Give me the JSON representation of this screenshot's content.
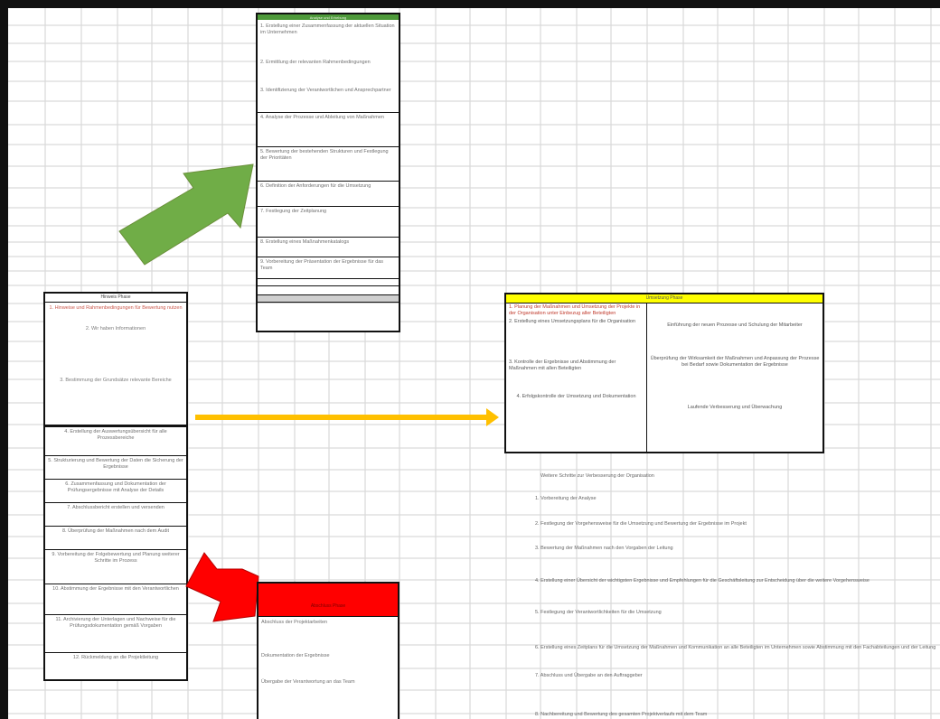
{
  "left_box": {
    "title": "Hinweis Phase",
    "cells": [
      "1. Hinweise und Rahmenbedingungen für Bewertung nutzen",
      "2. Wir haben Informationen",
      "3. Bestimmung der Grundsätze relevante Bereiche",
      "4. Erstellung der Auswertungsübersicht für alle Prozessbereiche",
      "5. Strukturierung und Bewertung der Daten die Sicherung der Ergebnisse",
      "6. Zusammenfassung und Dokumentation der Prüfungsergebnisse mit Analyse der Details",
      "7. Abschlussbericht erstellen und versenden",
      "8. Überprüfung der Maßnahmen nach dem Audit",
      "9. Vorbereitung der Folgebewertung und Planung weiterer Schritte im Prozess",
      "10. Abstimmung der Ergebnisse mit den Verantwortlichen",
      "11. Archivierung der Unterlagen und Nachweise für die Prüfungsdokumentation gemäß Vorgaben",
      "12. Rückmeldung an die Projektleitung"
    ]
  },
  "top_box": {
    "title": "Analyse und Erhebung",
    "cells": [
      "1. Erstellung einer Zusammenfassung der aktuellen Situation im Unternehmen",
      "2. Ermittlung der relevanten Rahmenbedingungen",
      "3. Identifizierung der Verantwortlichen und Ansprechpartner",
      "4. Analyse der Prozesse und Ableitung von Maßnahmen",
      "5. Bewertung der bestehenden Strukturen und Festlegung der Prioritäten",
      "6. Definition der Anforderungen für die Umsetzung",
      "7. Festlegung der Zeitplanung",
      "8. Erstellung eines Maßnahmenkatalogs",
      "9. Vorbereitung der Präsentation der Ergebnisse für das Team",
      "",
      "",
      ""
    ]
  },
  "right_box": {
    "title": "Umsetzung Phase",
    "left_col": [
      "1. Planung der Maßnahmen und Umsetzung der Projekte in der Organisation unter Einbezug aller Beteiligten",
      "2. Erstellung eines Umsetzungsplans für die Organisation",
      "3. Kontrolle der Ergebnisse und Abstimmung der Maßnahmen mit allen Beteiligten",
      "4. Erfolgskontrolle der Umsetzung und Dokumentation"
    ],
    "right_col": [
      "Einführung der neuen Prozesse und Schulung der Mitarbeiter",
      "Überprüfung der Wirksamkeit der Maßnahmen und Anpassung der Prozesse bei Bedarf sowie Dokumentation der Ergebnisse",
      "Laufende Verbesserung und Überwachung"
    ]
  },
  "bottom_box": {
    "title": "Abschluss Phase",
    "cells": [
      "Abschluss der Projektarbeiten",
      "Dokumentation der Ergebnisse",
      "Übergabe der Verantwortung an das Team"
    ]
  },
  "follow_list": [
    "Weitere Schritte zur Verbesserung der Organisation",
    "1. Vorbereitung der Analyse",
    "2. Festlegung der Vorgehensweise für die Umsetzung und Bewertung der Ergebnisse im Projekt",
    "3. Bewertung der Maßnahmen nach den Vorgaben der Leitung",
    "4. Erstellung einer Übersicht der wichtigsten Ergebnisse und Empfehlungen für die Geschäftsleitung zur Entscheidung über die weitere Vorgehensweise",
    "5. Festlegung der Verantwortlichkeiten für die Umsetzung",
    "6. Erstellung eines Zeitplans für die Umsetzung der Maßnahmen und Kommunikation an alle Beteiligten im Unternehmen sowie Abstimmung mit den Fachabteilungen und der Leitung",
    "7. Abschluss und Übergabe an den Auftraggeber",
    "8. Nachbereitung und Bewertung des gesamten Projektverlaufs mit dem Team"
  ],
  "colors": {
    "green_arrow": "#70ad47",
    "yellow_arrow": "#ffc000",
    "red_arrow": "#ff0000",
    "top_header": "#4e9a3a",
    "right_header": "#ffff00",
    "bottom_header": "#ff0000"
  }
}
